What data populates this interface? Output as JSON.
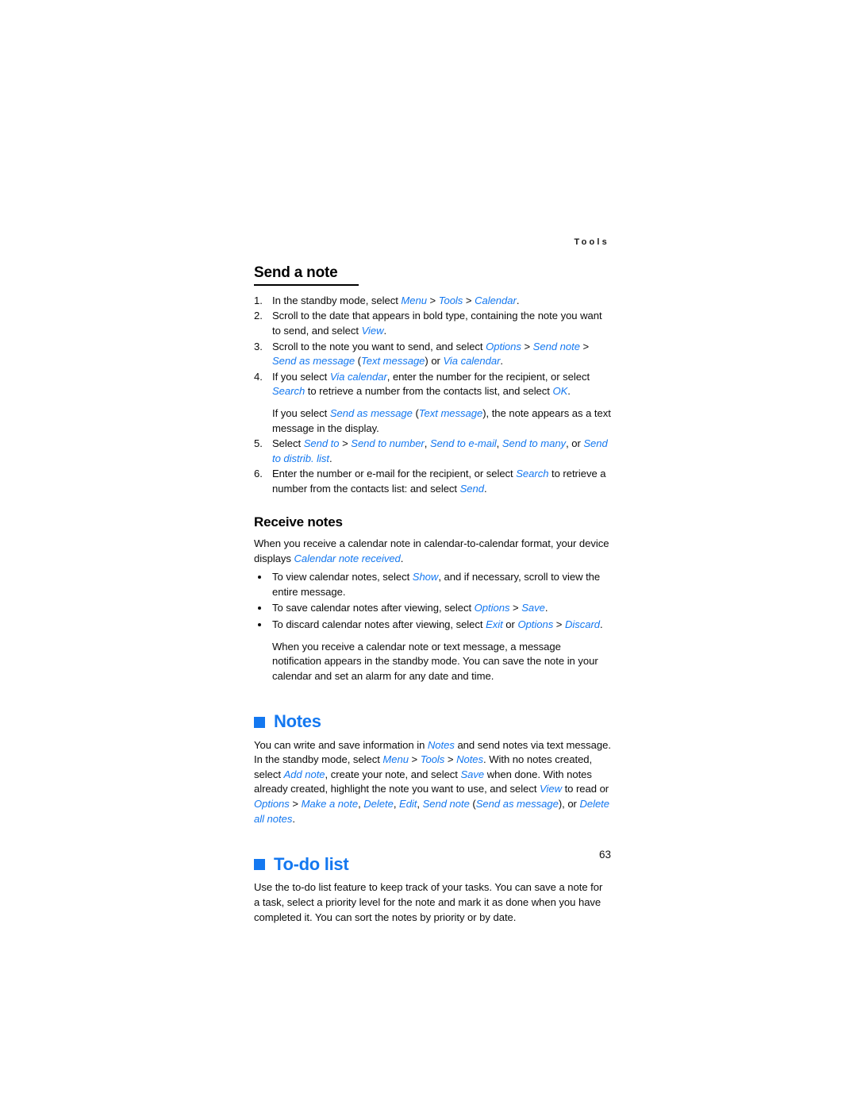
{
  "page": {
    "running_header": "Tools",
    "page_number": "63",
    "accent_color": "#1478f0",
    "text_color": "#0d0d0d",
    "background": "#ffffff"
  },
  "sections": {
    "send_a_note": {
      "heading": "Send a note",
      "steps": [
        {
          "number": "1.",
          "segments": [
            {
              "t": "In the standby mode, select ",
              "style": "plain"
            },
            {
              "t": "Menu",
              "style": "ui"
            },
            {
              "t": " > ",
              "style": "plain"
            },
            {
              "t": "Tools",
              "style": "ui"
            },
            {
              "t": " > ",
              "style": "plain"
            },
            {
              "t": "Calendar",
              "style": "ui"
            },
            {
              "t": ".",
              "style": "plain"
            }
          ]
        },
        {
          "number": "2.",
          "segments": [
            {
              "t": "Scroll to the date that appears in bold type, containing the note you want to send, and select ",
              "style": "plain"
            },
            {
              "t": "View",
              "style": "ui"
            },
            {
              "t": ".",
              "style": "plain"
            }
          ]
        },
        {
          "number": "3.",
          "segments": [
            {
              "t": "Scroll to the note you want to send, and select ",
              "style": "plain"
            },
            {
              "t": "Options",
              "style": "ui"
            },
            {
              "t": " > ",
              "style": "plain"
            },
            {
              "t": "Send note",
              "style": "ui"
            },
            {
              "t": " > ",
              "style": "plain"
            },
            {
              "t": "Send as message",
              "style": "ui"
            },
            {
              "t": " (",
              "style": "plain"
            },
            {
              "t": "Text message",
              "style": "ui"
            },
            {
              "t": ") or ",
              "style": "plain"
            },
            {
              "t": "Via calendar",
              "style": "ui"
            },
            {
              "t": ".",
              "style": "plain"
            }
          ]
        },
        {
          "number": "4.",
          "segments": [
            {
              "t": "If you select ",
              "style": "plain"
            },
            {
              "t": "Via calendar",
              "style": "ui"
            },
            {
              "t": ", enter the number for the recipient, or select ",
              "style": "plain"
            },
            {
              "t": "Search",
              "style": "ui"
            },
            {
              "t": " to retrieve a number from the contacts list, and select ",
              "style": "plain"
            },
            {
              "t": "OK",
              "style": "ui"
            },
            {
              "t": ".",
              "style": "plain"
            }
          ],
          "extra_paragraph": [
            {
              "t": "If you select ",
              "style": "plain"
            },
            {
              "t": "Send as message",
              "style": "ui"
            },
            {
              "t": " (",
              "style": "plain"
            },
            {
              "t": "Text message",
              "style": "ui"
            },
            {
              "t": "), the note appears as a text message in the display.",
              "style": "plain"
            }
          ]
        },
        {
          "number": "5.",
          "segments": [
            {
              "t": "Select ",
              "style": "plain"
            },
            {
              "t": "Send to",
              "style": "ui"
            },
            {
              "t": " > ",
              "style": "plain"
            },
            {
              "t": "Send to number",
              "style": "ui"
            },
            {
              "t": ", ",
              "style": "plain"
            },
            {
              "t": "Send to e-mail",
              "style": "ui"
            },
            {
              "t": ", ",
              "style": "plain"
            },
            {
              "t": "Send to many",
              "style": "ui"
            },
            {
              "t": ", or ",
              "style": "plain"
            },
            {
              "t": "Send to distrib. list",
              "style": "ui"
            },
            {
              "t": ".",
              "style": "plain"
            }
          ]
        },
        {
          "number": "6.",
          "segments": [
            {
              "t": "Enter the number or e-mail for the recipient, or select ",
              "style": "plain"
            },
            {
              "t": "Search",
              "style": "ui"
            },
            {
              "t": " to retrieve a number from the contacts list: and select ",
              "style": "plain"
            },
            {
              "t": "Send",
              "style": "ui"
            },
            {
              "t": ".",
              "style": "plain"
            }
          ]
        }
      ]
    },
    "receive_notes": {
      "heading": "Receive notes",
      "intro": [
        {
          "t": "When you receive a calendar note in calendar-to-calendar format, your device displays ",
          "style": "plain"
        },
        {
          "t": "Calendar note received",
          "style": "ui"
        },
        {
          "t": ".",
          "style": "plain"
        }
      ],
      "bullets": [
        {
          "segments": [
            {
              "t": "To view calendar notes, select ",
              "style": "plain"
            },
            {
              "t": "Show",
              "style": "ui"
            },
            {
              "t": ", and if necessary, scroll to view the entire message.",
              "style": "plain"
            }
          ]
        },
        {
          "segments": [
            {
              "t": "To save calendar notes after viewing, select ",
              "style": "plain"
            },
            {
              "t": "Options",
              "style": "ui"
            },
            {
              "t": " > ",
              "style": "plain"
            },
            {
              "t": "Save",
              "style": "ui"
            },
            {
              "t": ".",
              "style": "plain"
            }
          ]
        },
        {
          "segments": [
            {
              "t": "To discard calendar notes after viewing, select ",
              "style": "plain"
            },
            {
              "t": "Exit",
              "style": "ui"
            },
            {
              "t": " or ",
              "style": "plain"
            },
            {
              "t": "Options",
              "style": "ui"
            },
            {
              "t": " > ",
              "style": "plain"
            },
            {
              "t": "Discard",
              "style": "ui"
            },
            {
              "t": ".",
              "style": "plain"
            }
          ],
          "extra_paragraph": [
            {
              "t": "When you receive a calendar note or text message, a message notification appears in the standby mode. You can save the note in your calendar and set an alarm for any date and time.",
              "style": "plain"
            }
          ]
        }
      ]
    },
    "notes": {
      "heading": "Notes",
      "bullet_icon": "blue-square-icon",
      "body": [
        {
          "t": "You can write and save information in ",
          "style": "plain"
        },
        {
          "t": "Notes",
          "style": "ui"
        },
        {
          "t": " and send notes via text message. In the standby mode, select ",
          "style": "plain"
        },
        {
          "t": "Menu",
          "style": "ui"
        },
        {
          "t": " > ",
          "style": "plain"
        },
        {
          "t": "Tools",
          "style": "ui"
        },
        {
          "t": " > ",
          "style": "plain"
        },
        {
          "t": "Notes",
          "style": "ui"
        },
        {
          "t": ". With no notes created, select ",
          "style": "plain"
        },
        {
          "t": "Add note",
          "style": "ui"
        },
        {
          "t": ", create your note, and select ",
          "style": "plain"
        },
        {
          "t": "Save",
          "style": "ui"
        },
        {
          "t": " when done. With notes already created, highlight the note you want to use, and select ",
          "style": "plain"
        },
        {
          "t": "View",
          "style": "ui"
        },
        {
          "t": " to read or ",
          "style": "plain"
        },
        {
          "t": "Options",
          "style": "ui"
        },
        {
          "t": " > ",
          "style": "plain"
        },
        {
          "t": "Make a note",
          "style": "ui"
        },
        {
          "t": ", ",
          "style": "plain"
        },
        {
          "t": "Delete",
          "style": "ui"
        },
        {
          "t": ", ",
          "style": "plain"
        },
        {
          "t": "Edit",
          "style": "ui"
        },
        {
          "t": ", ",
          "style": "plain"
        },
        {
          "t": "Send note",
          "style": "ui"
        },
        {
          "t": " (",
          "style": "plain"
        },
        {
          "t": "Send as message",
          "style": "ui"
        },
        {
          "t": "), or ",
          "style": "plain"
        },
        {
          "t": "Delete all notes",
          "style": "ui"
        },
        {
          "t": ".",
          "style": "plain"
        }
      ]
    },
    "todo_list": {
      "heading": "To-do list",
      "bullet_icon": "blue-square-icon",
      "body": [
        {
          "t": "Use the to-do list feature to keep track of your tasks. You can save a note for a task, select a priority level for the note and mark it as done when you have completed it. You can sort the notes by priority or by date.",
          "style": "plain"
        }
      ]
    }
  }
}
